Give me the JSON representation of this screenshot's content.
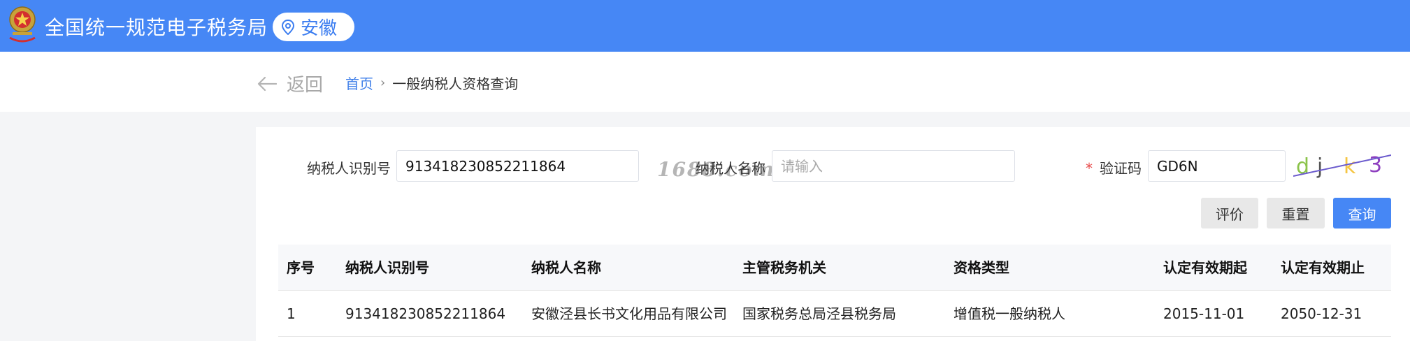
{
  "header": {
    "site_title": "全国统一规范电子税务局",
    "region": "安徽",
    "colors": {
      "brand": "#4687f5",
      "region_text": "#3d7ef0"
    }
  },
  "nav": {
    "back_label": "返回",
    "breadcrumb_home": "首页",
    "breadcrumb_separator": "›",
    "breadcrumb_current": "一般纳税人资格查询"
  },
  "form": {
    "taxpayer_id_label": "纳税人识别号",
    "taxpayer_id_value": "913418230852211864",
    "taxpayer_name_label": "纳税人名称",
    "taxpayer_name_placeholder": "请输入",
    "captcha_required_mark": "*",
    "captcha_label": "验证码",
    "captcha_value": "GD6N",
    "captcha_image_chars": [
      "d",
      "j",
      "k",
      "3"
    ],
    "watermark": "1688.com"
  },
  "buttons": {
    "evaluate": "评价",
    "reset": "重置",
    "query": "查询"
  },
  "table": {
    "columns": [
      "序号",
      "纳税人识别号",
      "纳税人名称",
      "主管税务机关",
      "资格类型",
      "认定有效期起",
      "认定有效期止"
    ],
    "rows": [
      [
        "1",
        "913418230852211864",
        "安徽泾县长书文化用品有限公司",
        "国家税务总局泾县税务局",
        "增值税一般纳税人",
        "2015-11-01",
        "2050-12-31"
      ]
    ]
  }
}
